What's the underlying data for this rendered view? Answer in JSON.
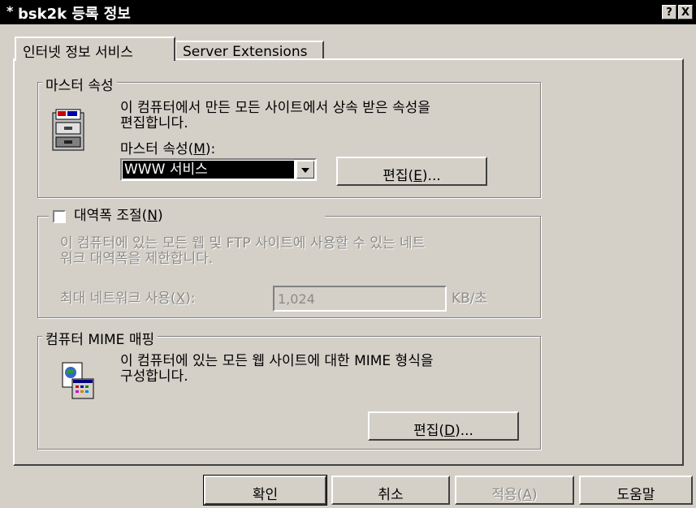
{
  "window": {
    "title": "bsk2k 등록 정보",
    "help_btn": "?",
    "close_btn": "X",
    "title_icon": "*"
  },
  "tabs": [
    {
      "label": "인터넷 정보 서비스",
      "active": true
    },
    {
      "label": "Server Extensions",
      "active": false
    }
  ],
  "master": {
    "legend": "마스터 속성",
    "description_line1": "이 컴퓨터에서 만든 모든 사이트에서 상속 받은 속성을",
    "description_line2": "편집합니다.",
    "prop_label_prefix": "마스터 속성(",
    "prop_label_key": "M",
    "prop_label_suffix": "):",
    "combo_value": "WWW 서비스",
    "edit_prefix": "편집(",
    "edit_key": "E",
    "edit_suffix": ")...",
    "icon": "folder-cabinet-icon"
  },
  "bandwidth": {
    "legend_prefix": "대역폭 조절(",
    "legend_key": "N",
    "legend_suffix": ")",
    "checked": false,
    "description_line1": "이 컴퓨터에 있는 모든 웹 및 FTP 사이트에 사용할 수 있는 네트",
    "description_line2": "워크 대역폭을 제한합니다.",
    "max_label_prefix": "최대 네트워크 사용(",
    "max_label_key": "X",
    "max_label_suffix": "):",
    "max_value": "1,024",
    "unit": "KB/초"
  },
  "mime": {
    "legend": "컴퓨터 MIME 매핑",
    "description_line1": "이 컴퓨터에 있는 모든 웹 사이트에 대한 MIME 형식을",
    "description_line2": "구성합니다.",
    "edit_prefix": "편집(",
    "edit_key": "D",
    "edit_suffix": ")...",
    "icon": "mime-map-icon"
  },
  "footer": {
    "ok": "확인",
    "cancel": "취소",
    "apply_prefix": "적용(",
    "apply_key": "A",
    "apply_suffix": ")",
    "help": "도움말"
  }
}
